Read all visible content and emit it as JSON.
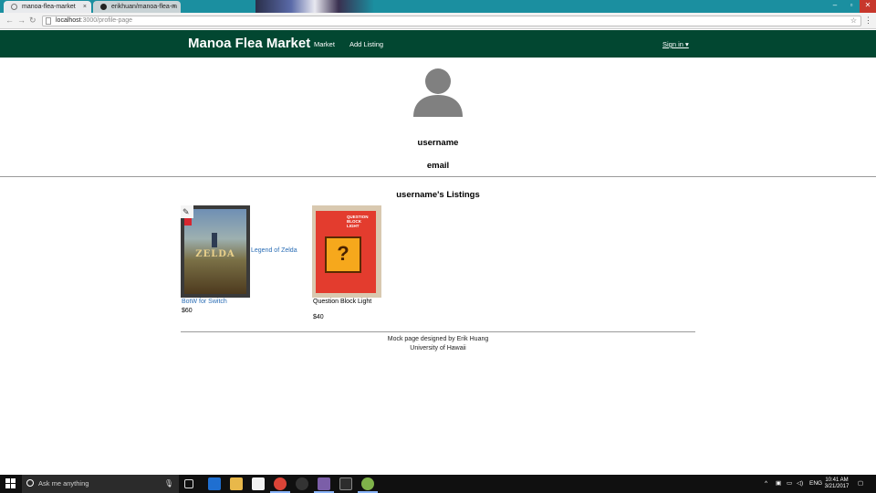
{
  "browser": {
    "tabs": [
      {
        "title": "manoa-flea-market",
        "active": true
      },
      {
        "title": "erikhuan/manoa-flea-m",
        "active": false
      }
    ],
    "close_glyph": "×",
    "window_controls": [
      "–",
      "▫",
      "✕"
    ],
    "url_host": "localhost",
    "url_path": ":3000/profile-page"
  },
  "nav": {
    "brand": "Manoa Flea Market",
    "links": [
      "Market",
      "Add Listing"
    ],
    "signin": "Sign in ▾"
  },
  "profile": {
    "username": "username",
    "email": "email",
    "listings_title": "username's Listings"
  },
  "listings": [
    {
      "name": "BotW for Switch",
      "price": "$60",
      "side_link": "Legend of Zelda",
      "box_text": "ZELDA"
    },
    {
      "name": "Question Block Light",
      "price": "$40",
      "box_text": "QUESTION BLOCK LIGHT",
      "block_glyph": "?"
    }
  ],
  "footer": {
    "line1": "Mock page designed by Erik Huang",
    "line2": "University of Hawaii"
  },
  "taskbar": {
    "search_placeholder": "Ask me anything",
    "language": "ENG",
    "time": "10:41 AM",
    "date": "3/21/2017"
  },
  "colors": {
    "navbar": "#024731",
    "link": "#2a6db5",
    "tabstrip": "#1b8fa0"
  }
}
